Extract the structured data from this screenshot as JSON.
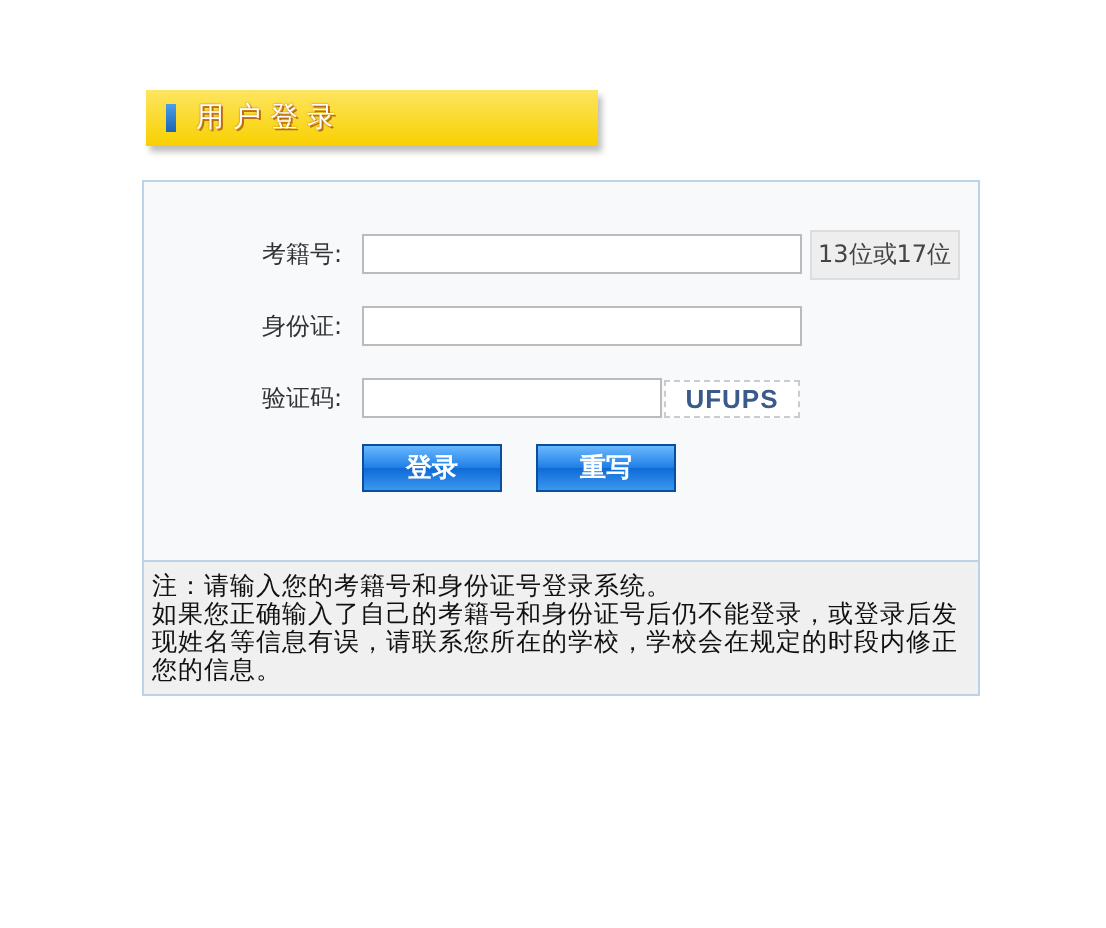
{
  "header": {
    "title": "用 户 登 录"
  },
  "fields": [
    {
      "kind": "text",
      "label": "考籍号:",
      "hint": "13位或17位"
    },
    {
      "kind": "text",
      "label": "身份证:"
    },
    {
      "kind": "captcha",
      "label": "验证码:",
      "code": "UFUPS"
    }
  ],
  "buttons": [
    "登录",
    "重写"
  ],
  "note": [
    "注：请输入您的考籍号和身份证号登录系统。",
    "如果您正确输入了自己的考籍号和身份证号后仍不能登录，或登录后发现姓名等信息有误，请联系您所在的学校，学校会在规定的时段内修正您的信息。"
  ]
}
